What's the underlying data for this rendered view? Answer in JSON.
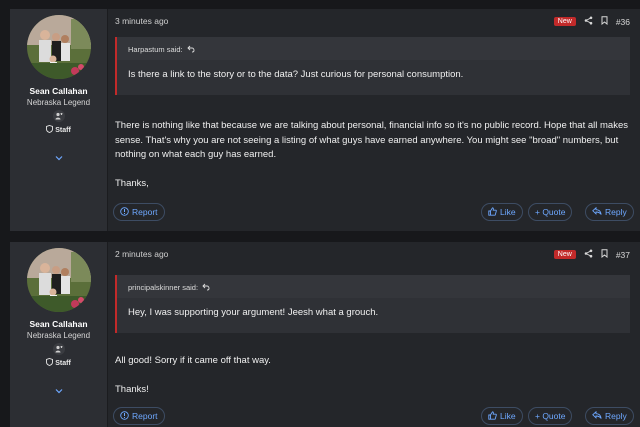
{
  "posts": [
    {
      "author": "Sean Callahan",
      "user_title": "Nebraska Legend",
      "staff_label": "Staff",
      "time": "3 minutes ago",
      "new_label": "New",
      "post_number": "#36",
      "quote_author": "Harpastum said:",
      "quote_text": "Is there a link to the story or to the data? Just curious for personal consumption.",
      "body": [
        "There is nothing like that because we are talking about personal, financial info so it's no public record. Hope that all makes sense. That's why you are not seeing a listing of what guys have earned anywhere. You might see \"broad\" numbers, but nothing on what each guy has earned.",
        "Thanks,"
      ],
      "report_label": "Report",
      "like_label": "Like",
      "quote_label": "+ Quote",
      "reply_label": "Reply"
    },
    {
      "author": "Sean Callahan",
      "user_title": "Nebraska Legend",
      "staff_label": "Staff",
      "time": "2 minutes ago",
      "new_label": "New",
      "post_number": "#37",
      "quote_author": "principalskinner said:",
      "quote_text": "Hey, I was supporting your argument! Jeesh what a grouch.",
      "body": [
        "All good! Sorry if it came off that way.",
        "Thanks!"
      ],
      "report_label": "Report",
      "like_label": "Like",
      "quote_label": "+ Quote",
      "reply_label": "Reply"
    }
  ],
  "colors": {
    "accent": "#6ea8ff",
    "new_badge": "#c22a2a",
    "background": "#17181b",
    "panel": "#24262a"
  },
  "icons": [
    "share-icon",
    "bookmark-icon",
    "flag-icon",
    "thumbs-up-icon",
    "reply-icon",
    "expand-chevron-icon",
    "shield-icon",
    "go-to-quote-icon",
    "trophy-icon"
  ]
}
